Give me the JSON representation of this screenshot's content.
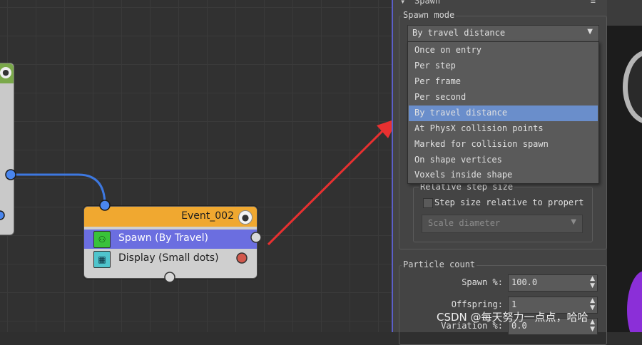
{
  "graph": {
    "event_node": {
      "title": "Event_002",
      "bulb_glyph": "💡",
      "operators": [
        {
          "label": "Spawn (By Travel)",
          "icon": "spawn-operator-icon",
          "selected": true
        },
        {
          "label": "Display (Small dots)",
          "icon": "display-operator-icon",
          "selected": false
        }
      ]
    },
    "wire_color": "#3d78e0",
    "arrow_color": "#e83030"
  },
  "panel": {
    "rollout_title": "Spawn",
    "spawn_mode": {
      "label": "Spawn mode",
      "selected": "By travel distance",
      "options": [
        "Once on entry",
        "Per step",
        "Per frame",
        "Per second",
        "By travel distance",
        "At PhysX collision points",
        "Marked for collision spawn",
        "On shape vertices",
        "Voxels inside shape"
      ],
      "highlight_color": "#6a8ecb"
    },
    "relative_step_size": {
      "label": "Relative step size",
      "checkbox_label": "Step size relative to propert",
      "scale_dropdown": "Scale diameter"
    },
    "particle_count": {
      "label": "Particle count",
      "spawn_pct_label": "Spawn %:",
      "spawn_pct": "100.0",
      "offspring_label": "Offspring:",
      "offspring": "1",
      "variation_label": "Variation %:",
      "variation": "0.0"
    }
  },
  "watermark": "CSDN @每天努力一点点，哈哈"
}
